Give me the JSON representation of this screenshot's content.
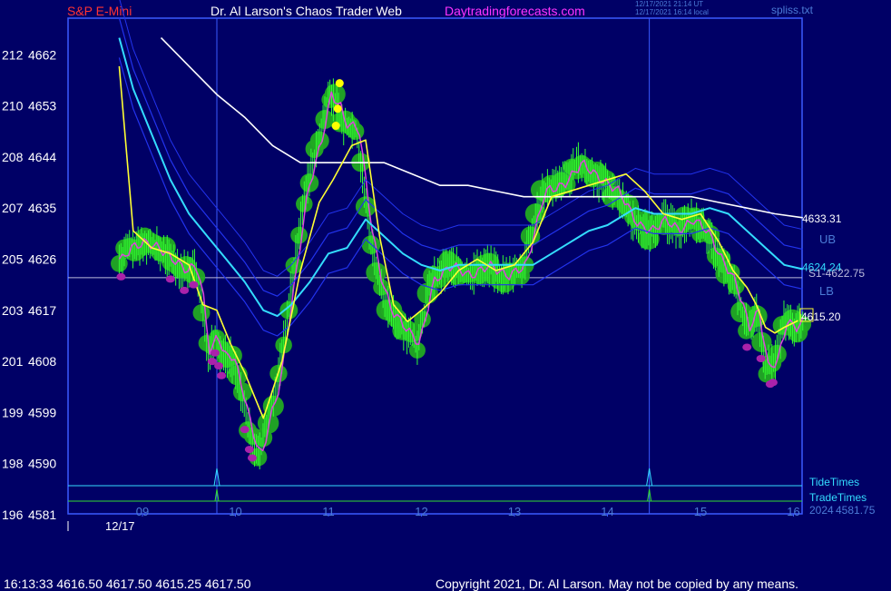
{
  "header": {
    "symbol": "S&P E-Mini",
    "title": "Dr. Al Larson's Chaos Trader Web",
    "site": "Daytradingforecasts.com",
    "timestamp_utc": "12/17/2021 21:14 UT",
    "timestamp_local": "12/17/2021 16:14 local",
    "file": "spliss.txt"
  },
  "colors": {
    "background": "#000066",
    "frame": "#3a5aff",
    "price_bars": "#33ff33",
    "flux_bubbles": "#22aa22",
    "moving_average_fast": "#ffff33",
    "moving_average_mid": "#33ddff",
    "moving_average_slow": "#ffffff",
    "bands": "#2233ee",
    "trend_line": "#dd44dd",
    "sell_markers": "#aa22aa",
    "buy_markers": "#ffff00",
    "tide_times": "#33ddff",
    "trade_times": "#33dd33",
    "support_line": "#bbbbdd"
  },
  "chart_data": {
    "type": "line",
    "title": "S&P E-Mini",
    "x_ticks": [
      "09",
      "10",
      "11",
      "12",
      "13",
      "14",
      "15",
      "16"
    ],
    "date_label": "12/17",
    "y_ticks_left": [
      {
        "emini": "212",
        "price": 4662
      },
      {
        "emini": "210",
        "price": 4653
      },
      {
        "emini": "208",
        "price": 4644
      },
      {
        "emini": "207",
        "price": 4635
      },
      {
        "emini": "205",
        "price": 4626
      },
      {
        "emini": "203",
        "price": 4617
      },
      {
        "emini": "201",
        "price": 4608
      },
      {
        "emini": "199",
        "price": 4599
      },
      {
        "emini": "198",
        "price": 4590
      },
      {
        "emini": "196",
        "price": 4581
      }
    ],
    "ylim": [
      4581,
      4665
    ],
    "xlim": [
      8.75,
      16.1
    ],
    "price_series": {
      "name": "S&P E-Mini price",
      "x": [
        8.75,
        8.85,
        9.0,
        9.15,
        9.3,
        9.45,
        9.55,
        9.62,
        9.7,
        9.78,
        9.85,
        9.95,
        10.05,
        10.15,
        10.25,
        10.33,
        10.45,
        10.6,
        10.75,
        10.9,
        11.0,
        11.1,
        11.15,
        11.3,
        11.45,
        11.55,
        11.65,
        11.8,
        11.95,
        12.1,
        12.3,
        12.5,
        12.7,
        12.9,
        13.1,
        13.3,
        13.5,
        13.7,
        13.9,
        14.1,
        14.3,
        14.45,
        14.6,
        14.75,
        14.9,
        15.05,
        15.2,
        15.35,
        15.5,
        15.6,
        15.7,
        15.8,
        15.9,
        16.0,
        16.1
      ],
      "values": [
        4626,
        4628,
        4629,
        4628,
        4626,
        4624,
        4625,
        4620,
        4609,
        4613,
        4609,
        4609,
        4603,
        4596,
        4591,
        4597,
        4604,
        4621,
        4638,
        4647,
        4655,
        4653,
        4650,
        4649,
        4630,
        4622,
        4617,
        4614,
        4611,
        4622,
        4625,
        4623,
        4625,
        4623,
        4625,
        4638,
        4639,
        4643,
        4640,
        4638,
        4632,
        4631,
        4633,
        4631,
        4633,
        4631,
        4626,
        4622,
        4614,
        4617,
        4607,
        4608,
        4615,
        4614,
        4615.25
      ]
    },
    "series": [
      {
        "name": "fast average",
        "x": [
          8.75,
          8.9,
          9.1,
          9.3,
          9.5,
          9.65,
          9.8,
          9.95,
          10.1,
          10.3,
          10.5,
          10.7,
          10.9,
          11.05,
          11.25,
          11.4,
          11.55,
          11.7,
          11.85,
          12.0,
          12.2,
          12.4,
          12.6,
          12.8,
          13.0,
          13.2,
          13.4,
          13.6,
          13.8,
          14.0,
          14.2,
          14.4,
          14.6,
          14.8,
          15.0,
          15.2,
          15.35,
          15.5,
          15.6,
          15.7,
          15.8,
          15.9,
          16.05
        ],
        "values": [
          4660,
          4631,
          4628,
          4627,
          4625,
          4618,
          4617,
          4611,
          4606,
          4598,
          4608,
          4624,
          4636,
          4640,
          4646,
          4647,
          4630,
          4618,
          4615,
          4617,
          4620,
          4624,
          4626,
          4624,
          4625,
          4629,
          4637,
          4638,
          4639,
          4640,
          4641,
          4638,
          4634,
          4633,
          4634,
          4629,
          4624,
          4621,
          4618,
          4614,
          4613,
          4614,
          4615.2
        ]
      },
      {
        "name": "mid average",
        "x": [
          8.75,
          8.9,
          9.1,
          9.3,
          9.5,
          9.7,
          9.9,
          10.1,
          10.3,
          10.45,
          10.6,
          10.8,
          11.0,
          11.2,
          11.4,
          11.6,
          11.8,
          12.0,
          12.2,
          12.4,
          12.6,
          12.8,
          13.0,
          13.2,
          13.4,
          13.6,
          13.8,
          14.0,
          14.2,
          14.3,
          14.5,
          14.7,
          14.9,
          15.1,
          15.3,
          15.5,
          15.7,
          15.9,
          16.1
        ],
        "values": [
          4665,
          4656,
          4648,
          4640,
          4634,
          4630,
          4626,
          4622,
          4617,
          4616,
          4618,
          4622,
          4627,
          4628,
          4633,
          4630,
          4627,
          4625,
          4624,
          4625,
          4625,
          4625,
          4625,
          4625,
          4627,
          4629,
          4631,
          4632,
          4634,
          4635,
          4634,
          4634,
          4634,
          4635,
          4634,
          4631,
          4628,
          4625,
          4624.24
        ]
      },
      {
        "name": "slow average",
        "x": [
          9.2,
          9.5,
          9.8,
          10.1,
          10.4,
          10.7,
          11.0,
          11.3,
          11.6,
          11.9,
          12.2,
          12.5,
          12.8,
          13.1,
          13.4,
          13.7,
          14.0,
          14.3,
          14.6,
          14.9,
          15.2,
          15.5,
          15.8,
          16.1
        ],
        "values": [
          4665,
          4660,
          4655,
          4651,
          4646,
          4643,
          4643,
          4643,
          4643,
          4641,
          4639,
          4639,
          4638,
          4637,
          4637,
          4637,
          4637,
          4637,
          4637,
          4637,
          4636,
          4635,
          4634,
          4633.31
        ]
      }
    ],
    "support_level": {
      "label": "S1-4622.75",
      "value": 4622.75
    },
    "band_labels": {
      "upper": "UB",
      "lower": "LB"
    },
    "last_values": {
      "slow": "4633.31",
      "mid": "4624.24",
      "fast": "4615.20"
    },
    "vertical_lines": [
      9.8,
      14.45
    ],
    "timing_lines": {
      "tide_label": "TideTimes",
      "trade_label": "TradeTimes",
      "spikes_x": [
        9.8,
        14.45
      ]
    },
    "overlap_label_a": "2024",
    "overlap_label_b": "4581.75",
    "grid": false,
    "legend": "none"
  },
  "footer": {
    "quote": "16:13:33  4616.50 4617.50 4615.25 4617.50",
    "copyright": "Copyright 2021, Dr. Al Larson. May not be copied by any means."
  }
}
